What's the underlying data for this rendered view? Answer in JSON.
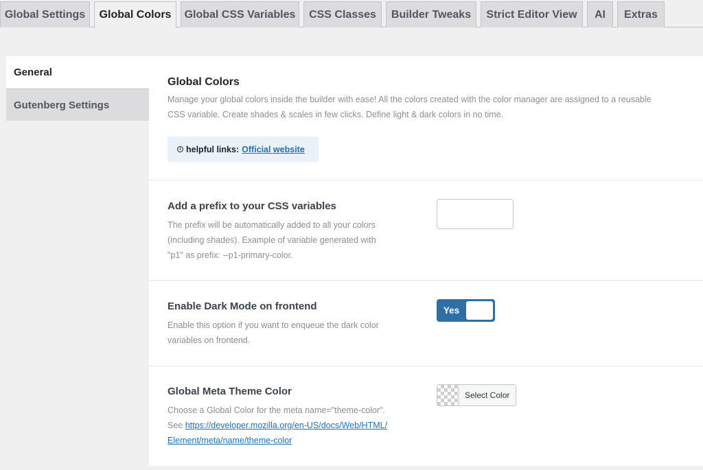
{
  "tabs": [
    {
      "label": "Global Settings",
      "active": false
    },
    {
      "label": "Global Colors",
      "active": true
    },
    {
      "label": "Global CSS Variables",
      "active": false
    },
    {
      "label": "CSS Classes",
      "active": false
    },
    {
      "label": "Builder Tweaks",
      "active": false
    },
    {
      "label": "Strict Editor View",
      "active": false
    },
    {
      "label": "AI",
      "active": false
    },
    {
      "label": "Extras",
      "active": false
    }
  ],
  "subnav": [
    {
      "label": "General",
      "active": true
    },
    {
      "label": "Gutenberg Settings",
      "active": false
    }
  ],
  "intro": {
    "title": "Global Colors",
    "desc_line1": "Manage your global colors inside the builder with ease! All the colors created with the color manager are assigned to a reusable",
    "desc_line2": "CSS variable. Create shades & scales in few clicks. Define light & dark colors in no time.",
    "helpful_label": "helpful links:",
    "helpful_link": "Official website",
    "info_icon": "info-circle-icon"
  },
  "prefix": {
    "label": "Add a prefix to your CSS variables",
    "desc_line1": "The prefix will be automatically added to all your colors",
    "desc_line2": "(including shades). Example of variable generated with",
    "desc_line3": "\"p1\" as prefix: --p1-primary-color.",
    "value": ""
  },
  "dark_mode": {
    "label": "Enable Dark Mode on frontend",
    "desc_line1": "Enable this option if you want to enqueue the dark color",
    "desc_line2": "variables on frontend.",
    "toggle_label": "Yes",
    "enabled": true
  },
  "meta_theme": {
    "label": "Global Meta Theme Color",
    "desc_line1": "Choose a Global Color for the meta name=\"theme-color\".",
    "desc_see": "See ",
    "link_line1": "https://developer.mozilla.org/en-US/docs/Web/HTML/",
    "link_line2": "Element/meta/name/theme-color",
    "button_label": "Select Color"
  },
  "colors": {
    "accent": "#2f6fa7",
    "link": "#2271b1",
    "panel_bg": "#ffffff",
    "page_bg": "#f0f0f1"
  }
}
